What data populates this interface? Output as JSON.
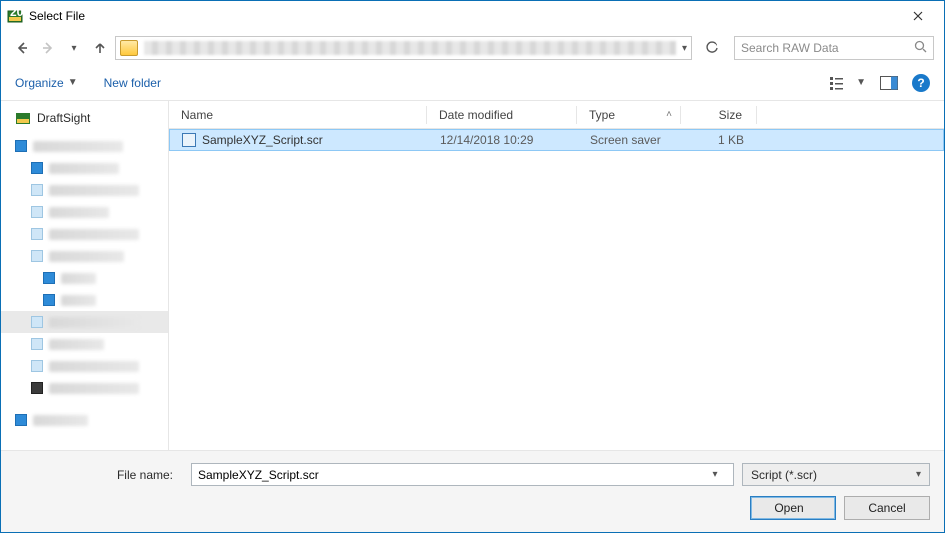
{
  "window": {
    "title": "Select File"
  },
  "nav": {
    "search_placeholder": "Search RAW Data"
  },
  "toolbar": {
    "organize": "Organize",
    "new_folder": "New folder"
  },
  "sidebar": {
    "draftsight": "DraftSight"
  },
  "columns": {
    "name": "Name",
    "date": "Date modified",
    "type": "Type",
    "size": "Size"
  },
  "files": [
    {
      "name": "SampleXYZ_Script.scr",
      "date": "12/14/2018 10:29",
      "type": "Screen saver",
      "size": "1 KB"
    }
  ],
  "footer": {
    "filename_label": "File name:",
    "filename_value": "SampleXYZ_Script.scr",
    "filter": "Script (*.scr)",
    "open": "Open",
    "cancel": "Cancel"
  }
}
